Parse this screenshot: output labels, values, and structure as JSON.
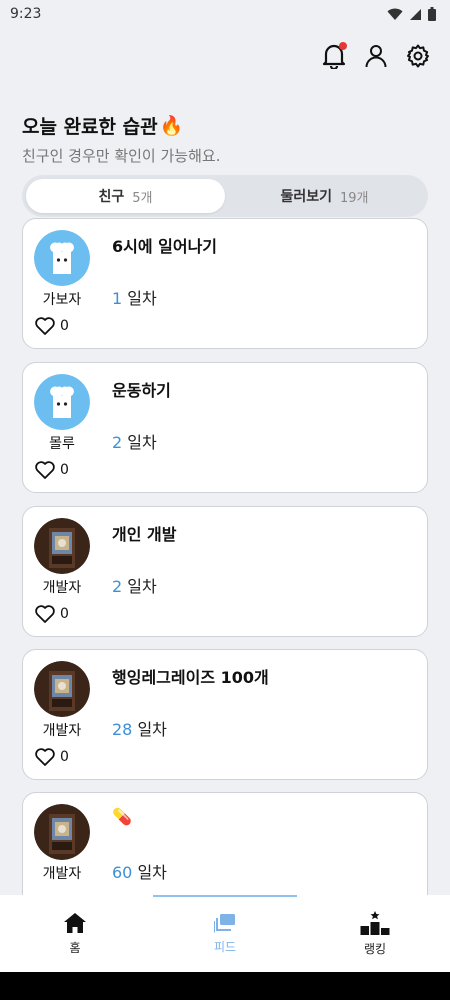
{
  "status_bar": {
    "time": "9:23"
  },
  "header": {
    "title": "오늘 완료한 습관",
    "title_emoji": "🔥",
    "subtitle": "친구인 경우만 확인이 가능해요."
  },
  "tabs": [
    {
      "label": "친구",
      "count": "5개",
      "active": true
    },
    {
      "label": "둘러보기",
      "count": "19개",
      "active": false
    }
  ],
  "feed": [
    {
      "author": "가보자",
      "avatar": "rabbit",
      "title": "6시에 일어나기",
      "days": "1",
      "unit": "일차",
      "likes": "0"
    },
    {
      "author": "몰루",
      "avatar": "rabbit",
      "title": "운동하기",
      "days": "2",
      "unit": "일차",
      "likes": "0"
    },
    {
      "author": "개발자",
      "avatar": "photo",
      "title": "개인 개발",
      "days": "2",
      "unit": "일차",
      "likes": "0"
    },
    {
      "author": "개발자",
      "avatar": "photo",
      "title": "행잉레그레이즈 100개",
      "days": "28",
      "unit": "일차",
      "likes": "0"
    },
    {
      "author": "개발자",
      "avatar": "photo",
      "title": "💊",
      "days": "60",
      "unit": "일차",
      "likes": ""
    }
  ],
  "nav": [
    {
      "label": "홈",
      "icon": "home-icon",
      "active": false
    },
    {
      "label": "피드",
      "icon": "feed-icon",
      "active": true
    },
    {
      "label": "랭킹",
      "icon": "ranking-icon",
      "active": false
    }
  ],
  "colors": {
    "accent": "#3d8fd6",
    "notification": "#e53935",
    "rabbit": "#6cbef0",
    "nav_active": "#7eb3e8"
  }
}
